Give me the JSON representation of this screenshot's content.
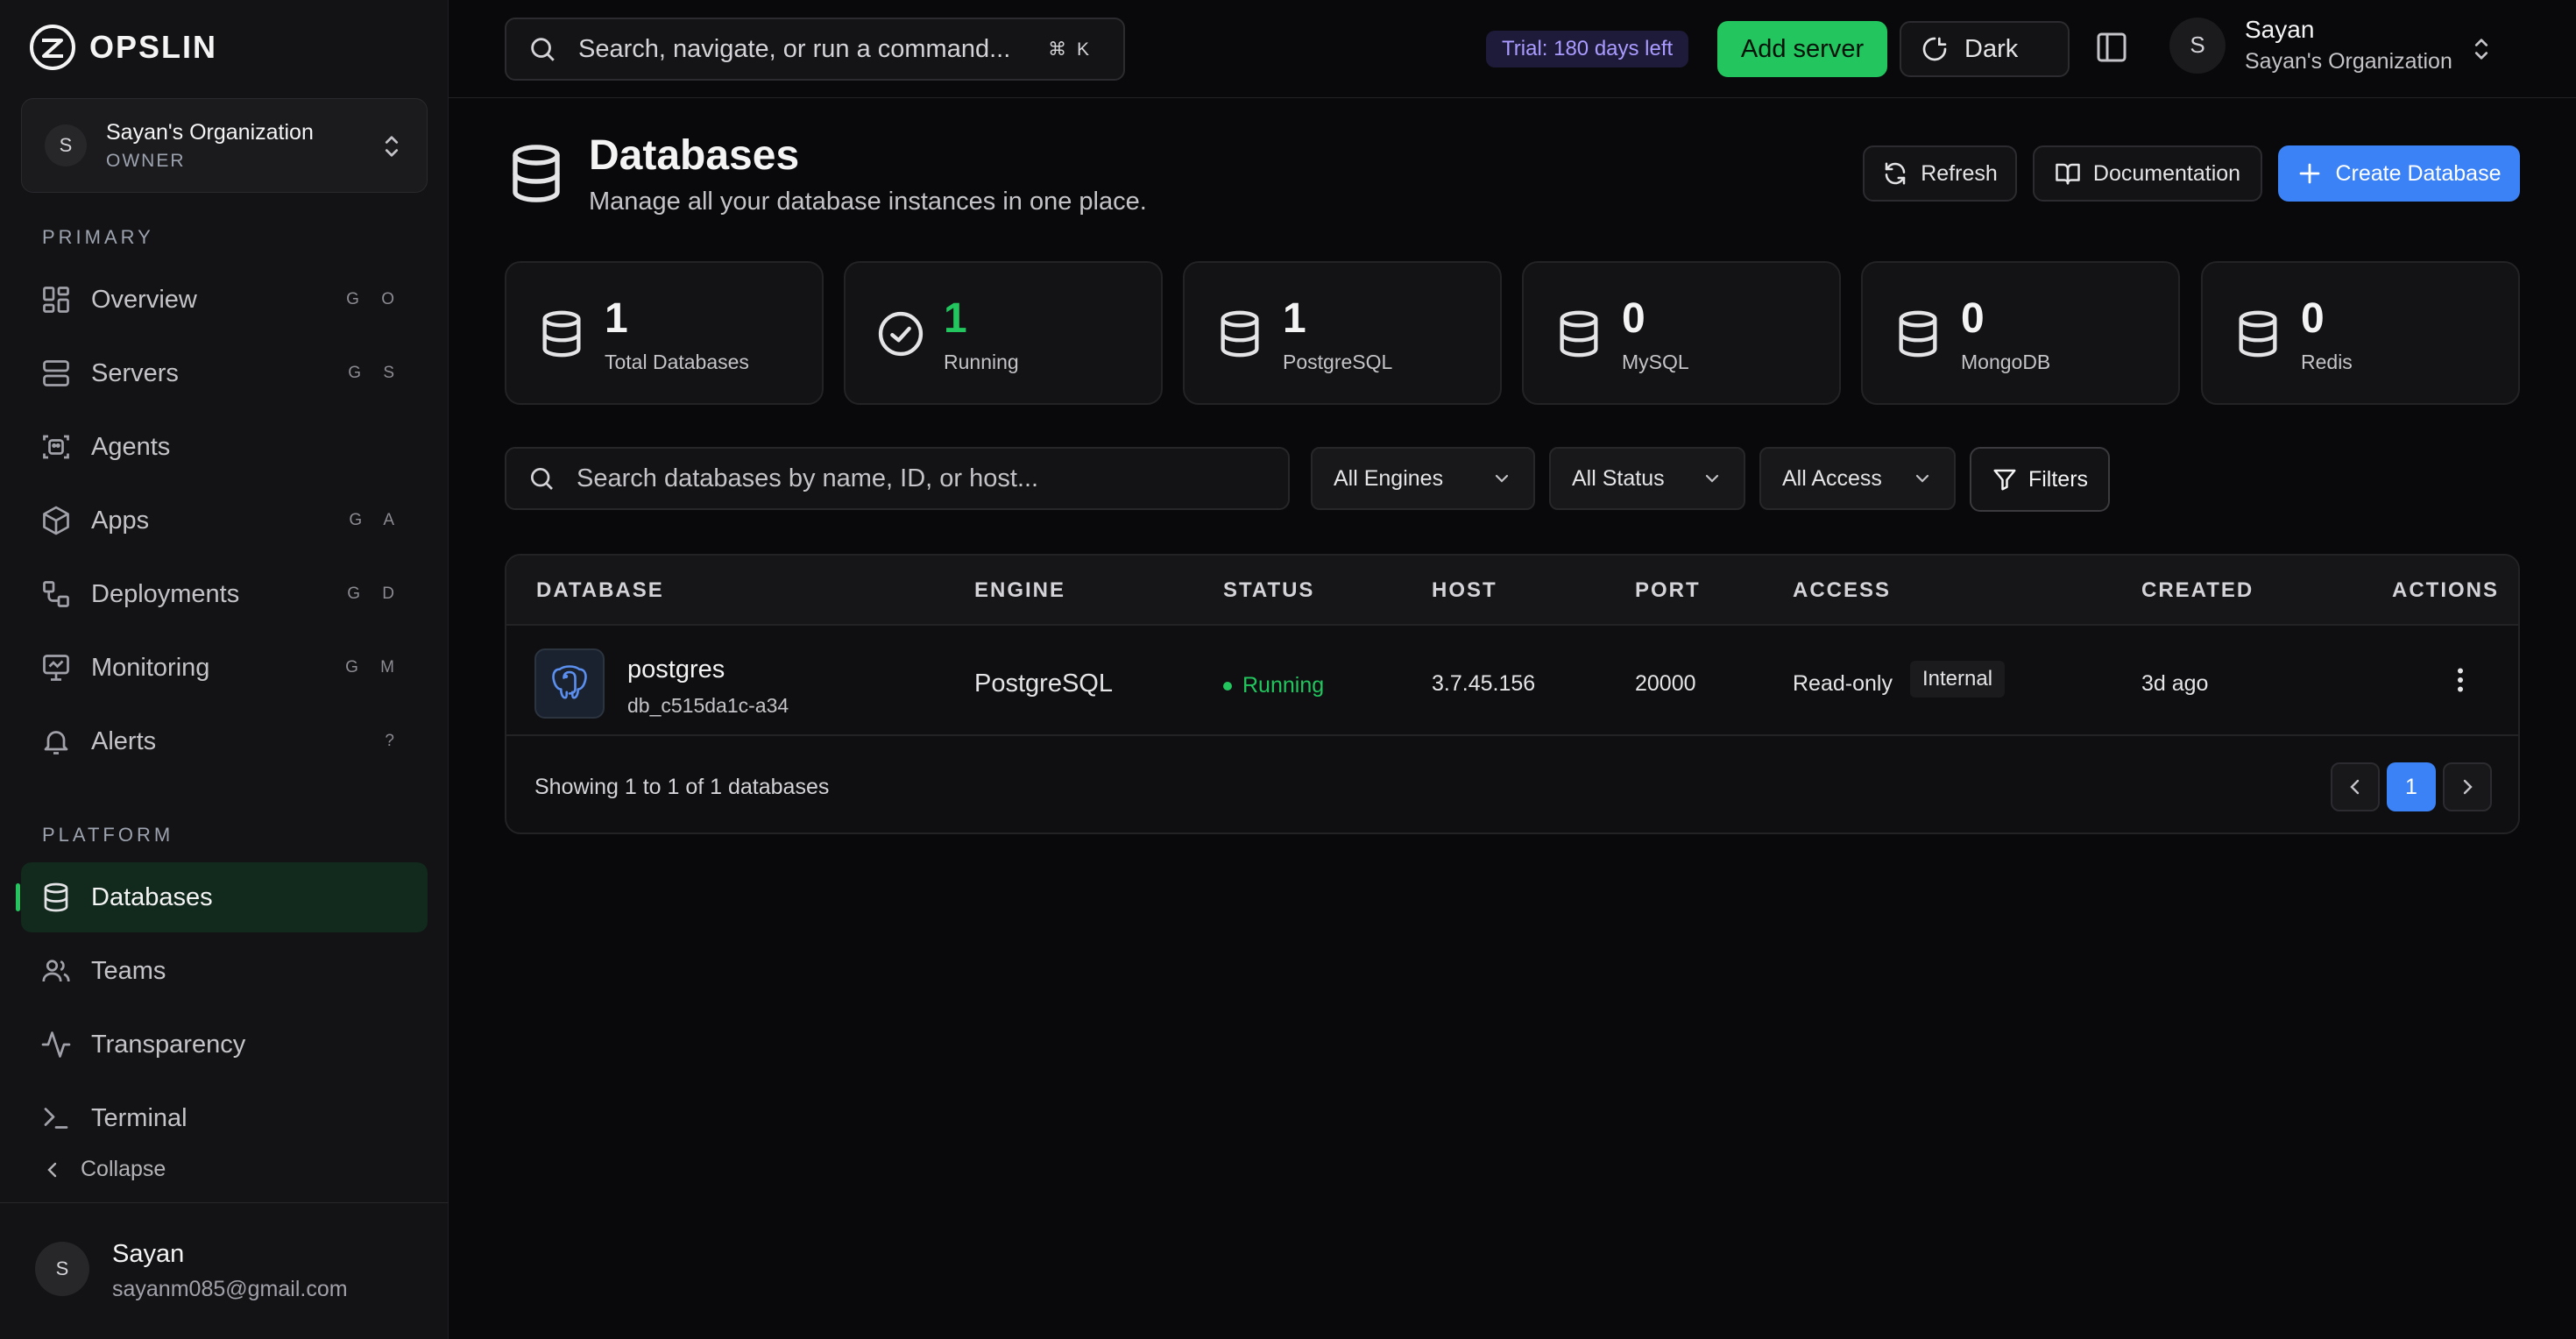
{
  "brand": {
    "name": "OPSLIN"
  },
  "org": {
    "initial": "S",
    "name": "Sayan's Organization",
    "role": "OWNER"
  },
  "sidebar": {
    "primary_label": "PRIMARY",
    "platform_label": "PLATFORM",
    "primary": [
      {
        "label": "Overview",
        "kbd": "G O",
        "icon": "grid-icon"
      },
      {
        "label": "Servers",
        "kbd": "G S",
        "icon": "server-icon"
      },
      {
        "label": "Agents",
        "kbd": "",
        "icon": "agent-icon"
      },
      {
        "label": "Apps",
        "kbd": "G A",
        "icon": "box-icon"
      },
      {
        "label": "Deployments",
        "kbd": "G D",
        "icon": "deploy-icon"
      },
      {
        "label": "Monitoring",
        "kbd": "G M",
        "icon": "monitor-icon"
      },
      {
        "label": "Alerts",
        "kbd": "?",
        "icon": "bell-icon"
      }
    ],
    "platform": [
      {
        "label": "Databases",
        "icon": "database-icon",
        "active": true
      },
      {
        "label": "Teams",
        "icon": "users-icon"
      },
      {
        "label": "Transparency",
        "icon": "activity-icon"
      },
      {
        "label": "Terminal",
        "icon": "terminal-icon"
      }
    ],
    "collapse_label": "Collapse"
  },
  "user": {
    "initial": "S",
    "name": "Sayan",
    "email": "sayanm085@gmail.com",
    "org": "Sayan's Organization"
  },
  "topbar": {
    "search_placeholder": "Search, navigate, or run a command...",
    "search_kbd": "⌘ K",
    "trial": "Trial: 180 days left",
    "add_server": "Add server",
    "theme": "Dark"
  },
  "page": {
    "title": "Databases",
    "subtitle": "Manage all your database instances in one place.",
    "refresh": "Refresh",
    "documentation": "Documentation",
    "create": "Create Database"
  },
  "stats": [
    {
      "value": "1",
      "label": "Total Databases",
      "icon": "database-icon"
    },
    {
      "value": "1",
      "label": "Running",
      "icon": "check-circle-icon",
      "accent": "#22c55e"
    },
    {
      "value": "1",
      "label": "PostgreSQL",
      "icon": "database-icon"
    },
    {
      "value": "0",
      "label": "MySQL",
      "icon": "database-icon"
    },
    {
      "value": "0",
      "label": "MongoDB",
      "icon": "database-icon"
    },
    {
      "value": "0",
      "label": "Redis",
      "icon": "database-icon"
    }
  ],
  "filters": {
    "search_placeholder": "Search databases by name, ID, or host...",
    "engines": "All Engines",
    "status": "All Status",
    "access": "All Access",
    "filters_button": "Filters"
  },
  "table": {
    "columns": [
      "DATABASE",
      "ENGINE",
      "STATUS",
      "HOST",
      "PORT",
      "ACCESS",
      "CREATED",
      "ACTIONS"
    ],
    "rows": [
      {
        "name": "postgres",
        "id": "db_c515da1c-a34",
        "engine": "PostgreSQL",
        "status": "Running",
        "host": "3.7.45.156",
        "port": "20000",
        "access": "Read-only",
        "access_tag": "Internal",
        "created": "3d ago"
      }
    ],
    "footer": "Showing 1 to 1 of 1 databases",
    "current_page": "1"
  },
  "colors": {
    "accent_green": "#22c55e",
    "accent_blue": "#3b82f6",
    "trial_purple": "#a99bff"
  }
}
